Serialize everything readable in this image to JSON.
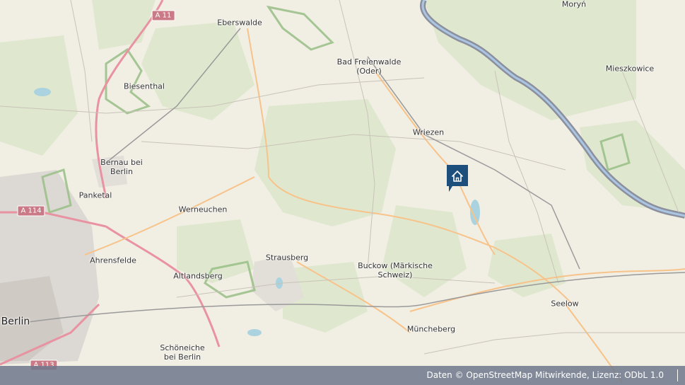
{
  "map": {
    "places": {
      "moryn": "Moryń",
      "eberswalde": "Eberswalde",
      "bad_freienwalde": "Bad Freienwalde\n(Oder)",
      "mieszkowice": "Mieszkowice",
      "biesenthal": "Biesenthal",
      "wriezen": "Wriezen",
      "bernau": "Bernau bei\nBerlin",
      "panketal": "Panketal",
      "werneuchen": "Werneuchen",
      "strausberg": "Strausberg",
      "buckow": "Buckow (Märkische\nSchweiz)",
      "ahrensfelde": "Ahrensfelde",
      "altlandsberg": "Altlandsberg",
      "seelow": "Seelow",
      "berlin": "Berlin",
      "muencheberg": "Müncheberg",
      "schoeneiche": "Schöneiche\nbei Berlin"
    },
    "road_shields": {
      "a11": "A 11",
      "a114": "A 114",
      "a113": "A 113"
    },
    "marker_icon": "home-icon",
    "marker_color": "#1d4f7c"
  },
  "attribution": {
    "text": "Daten © OpenStreetMap Mitwirkende, Lizenz: ODbL 1.0"
  }
}
